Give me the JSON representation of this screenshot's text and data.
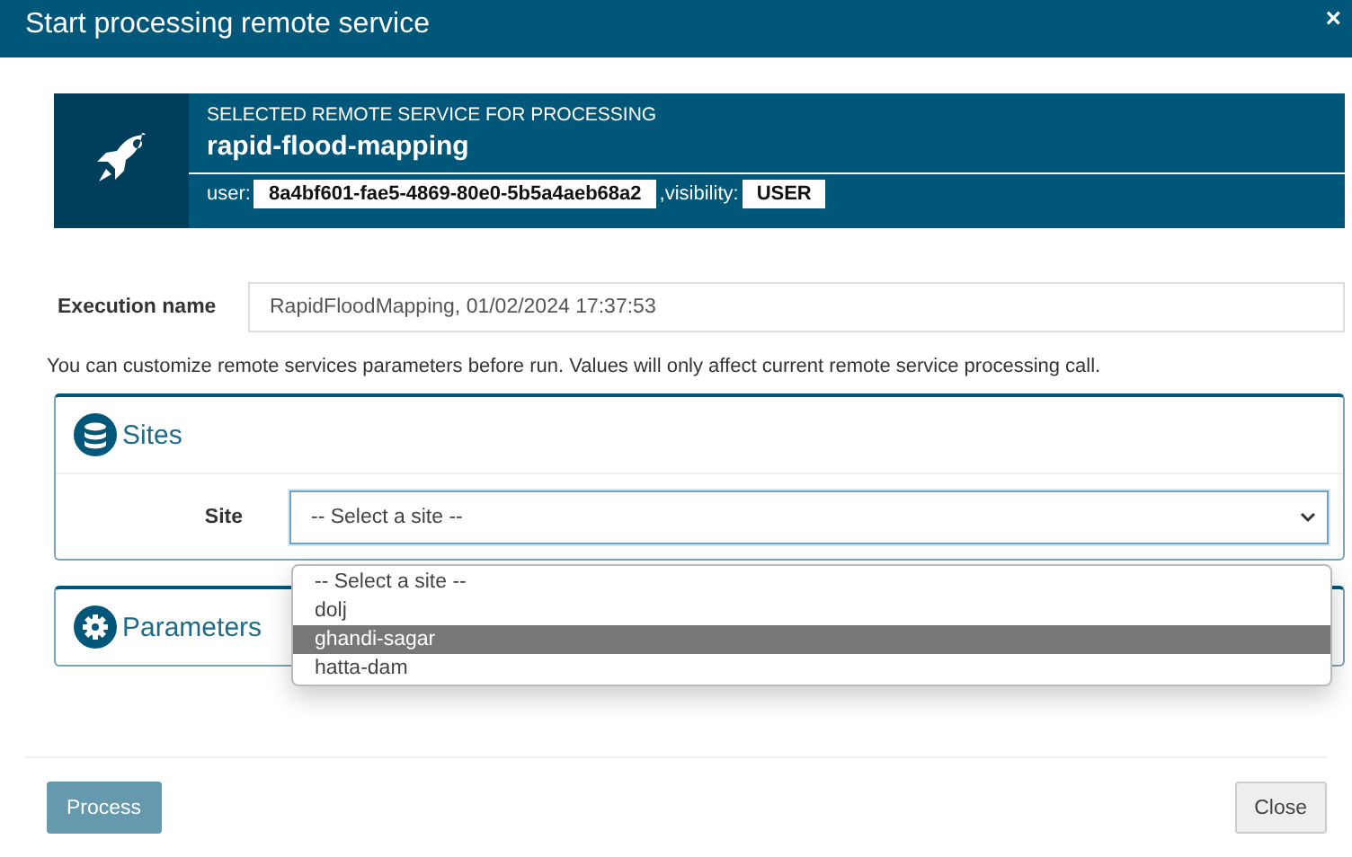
{
  "window": {
    "title": "Start processing remote service",
    "close": "×"
  },
  "service": {
    "caption": "SELECTED REMOTE SERVICE FOR PROCESSING",
    "name": "rapid-flood-mapping",
    "user_label": "user:",
    "user": "8a4bf601-fae5-4869-80e0-5b5a4aeb68a2",
    "visibility_label": ",visibility:",
    "visibility": "USER"
  },
  "execution_name": {
    "label": "Execution name",
    "value": "RapidFloodMapping, 01/02/2024 17:37:53"
  },
  "hint": "You can customize remote services parameters before run. Values will only affect current remote service processing call.",
  "sites": {
    "title": "Sites",
    "field_label": "Site",
    "value": "-- Select a site --",
    "expanded": true,
    "options": [
      {
        "label": "-- Select a site --",
        "highlighted": false
      },
      {
        "label": "dolj",
        "highlighted": false
      },
      {
        "label": "ghandi-sagar",
        "highlighted": true
      },
      {
        "label": "hatta-dam",
        "highlighted": false
      }
    ]
  },
  "parameters": {
    "title": "Parameters",
    "expanded": false
  },
  "buttons": [
    {
      "label": "Process",
      "kind": "primary",
      "disabled": true
    },
    {
      "label": "Close",
      "kind": "default",
      "disabled": false
    }
  ]
}
